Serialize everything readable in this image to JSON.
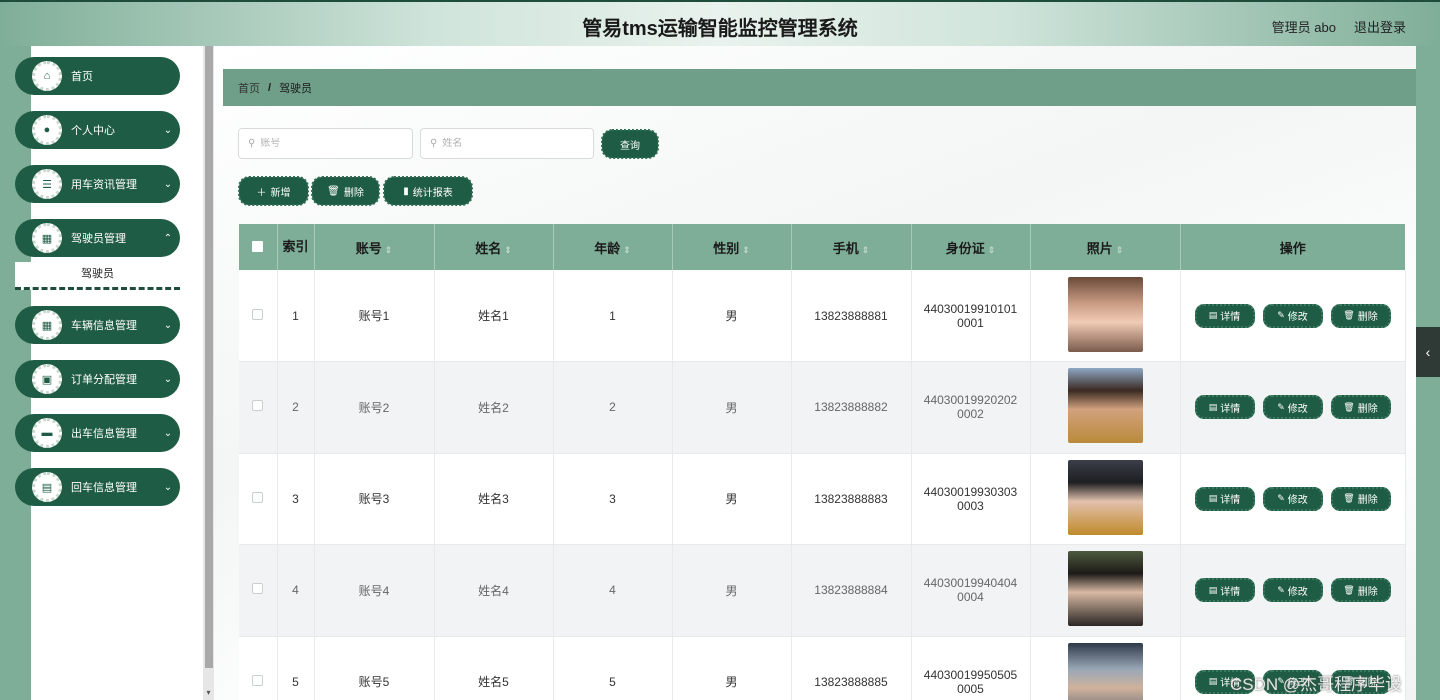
{
  "header": {
    "title": "管易tms运输智能监控管理系统",
    "user": "管理员 abo",
    "logout": "退出登录"
  },
  "sidebar": {
    "items": [
      {
        "label": "首页",
        "icon": "home-icon",
        "glyph": "⌂",
        "has_chevron": false
      },
      {
        "label": "个人中心",
        "icon": "user-icon",
        "glyph": "●",
        "has_chevron": true
      },
      {
        "label": "用车资讯管理",
        "icon": "sliders-icon",
        "glyph": "☰",
        "has_chevron": true
      },
      {
        "label": "驾驶员管理",
        "icon": "grid-icon",
        "glyph": "▦",
        "has_chevron": true
      },
      {
        "label": "车辆信息管理",
        "icon": "apps-icon",
        "glyph": "▦",
        "has_chevron": true
      },
      {
        "label": "订单分配管理",
        "icon": "chart-icon",
        "glyph": "▣",
        "has_chevron": true
      },
      {
        "label": "出车信息管理",
        "icon": "ticket-icon",
        "glyph": "▬",
        "has_chevron": true
      },
      {
        "label": "回车信息管理",
        "icon": "clipboard-icon",
        "glyph": "▤",
        "has_chevron": true
      }
    ],
    "submenu": "驾驶员"
  },
  "breadcrumb": {
    "home": "首页",
    "separator": "/",
    "current": "驾驶员"
  },
  "search": {
    "account_placeholder": "账号",
    "name_placeholder": "姓名",
    "query_button": "查询"
  },
  "toolbar": {
    "add": "新增",
    "delete": "删除",
    "report": "统计报表"
  },
  "table": {
    "headers": {
      "index": "索引",
      "account": "账号",
      "name": "姓名",
      "age": "年龄",
      "gender": "性别",
      "phone": "手机",
      "id_card": "身份证",
      "photo": "照片",
      "actions": "操作"
    },
    "rows": [
      {
        "index": "1",
        "account": "账号1",
        "name": "姓名1",
        "age": "1",
        "gender": "男",
        "phone": "13823888881",
        "id_line1": "44030019910101",
        "id_line2": "0001"
      },
      {
        "index": "2",
        "account": "账号2",
        "name": "姓名2",
        "age": "2",
        "gender": "男",
        "phone": "13823888882",
        "id_line1": "44030019920202",
        "id_line2": "0002"
      },
      {
        "index": "3",
        "account": "账号3",
        "name": "姓名3",
        "age": "3",
        "gender": "男",
        "phone": "13823888883",
        "id_line1": "44030019930303",
        "id_line2": "0003"
      },
      {
        "index": "4",
        "account": "账号4",
        "name": "姓名4",
        "age": "4",
        "gender": "男",
        "phone": "13823888884",
        "id_line1": "44030019940404",
        "id_line2": "0004"
      },
      {
        "index": "5",
        "account": "账号5",
        "name": "姓名5",
        "age": "5",
        "gender": "男",
        "phone": "13823888885",
        "id_line1": "44030019950505",
        "id_line2": "0005"
      }
    ],
    "actions": {
      "detail": "详情",
      "edit": "修改",
      "delete": "删除"
    }
  },
  "watermark": "CSDN @杰哥程序毕设",
  "colors": {
    "primary": "#1f5c45",
    "header_row": "#7fae98",
    "breadcrumb_bar": "#6f9f88"
  }
}
